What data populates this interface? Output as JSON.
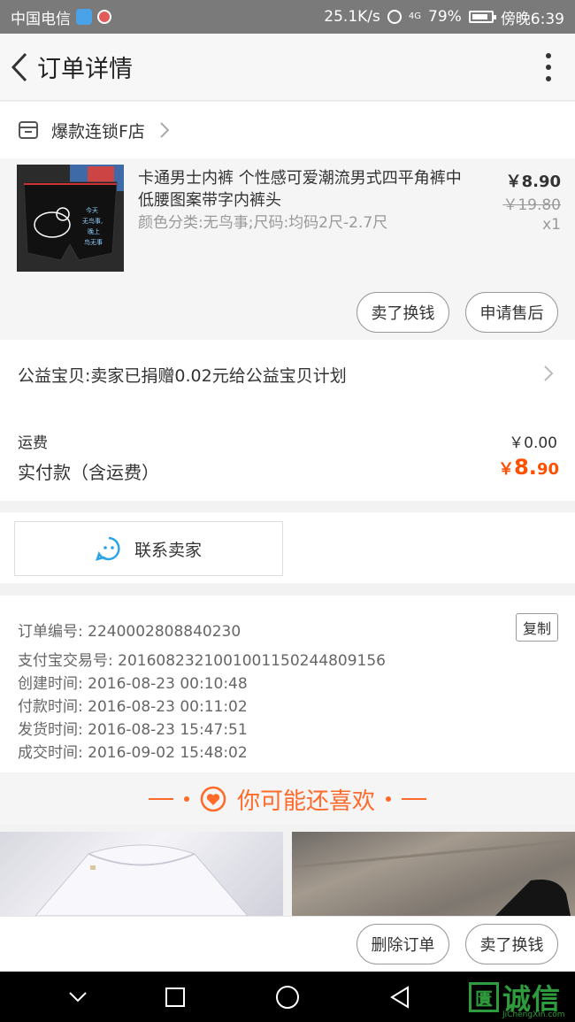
{
  "status_bar": {
    "carrier": "中国电信",
    "speed": "25.1K/s",
    "signal": "4G",
    "battery": "79%",
    "time": "傍晚6:39"
  },
  "header": {
    "title": "订单详情"
  },
  "shop": {
    "name": "爆款连锁F店"
  },
  "product": {
    "title": "卡通男士内裤 个性感可爱潮流男式四平角裤中低腰图案带字内裤头",
    "sku": "颜色分类:无鸟事;尺码:均码2尺-2.7尺",
    "price": "￥8.90",
    "original_price": "￥19.80",
    "quantity": "x1",
    "thumb_text": [
      "今天",
      "无鸟事,",
      "晚上",
      "鸟无事"
    ],
    "actions": {
      "sell_label": "卖了换钱",
      "after_sale_label": "申请售后"
    }
  },
  "charity": {
    "text": "公益宝贝:卖家已捐赠0.02元给公益宝贝计划"
  },
  "fees": {
    "shipping_label": "运费",
    "shipping_value": "￥0.00",
    "paid_label": "实付款（含运费）",
    "paid_currency": "￥",
    "paid_integer": "8.",
    "paid_decimal": "90"
  },
  "contact": {
    "label": "联系卖家"
  },
  "order_info": {
    "order_no": "订单编号: 2240002808840230",
    "alipay_no": "支付宝交易号: 2016082321001001150244809156",
    "created": "创建时间: 2016-08-23 00:10:48",
    "paid": "付款时间: 2016-08-23 00:11:02",
    "shipped": "发货时间: 2016-08-23 15:47:51",
    "completed": "成交时间: 2016-09-02 15:48:02",
    "copy_label": "复制"
  },
  "recommend": {
    "title": "你可能还喜欢"
  },
  "bottom_actions": {
    "delete_label": "删除订单",
    "sell_label": "卖了换钱"
  },
  "watermark": {
    "box_char": "匱",
    "text": "诚信",
    "sub": "JiChengXin.com"
  },
  "colors": {
    "accent": "#ff5000",
    "recommend": "#ff6a2a",
    "contact_icon": "#2aa4e6"
  }
}
